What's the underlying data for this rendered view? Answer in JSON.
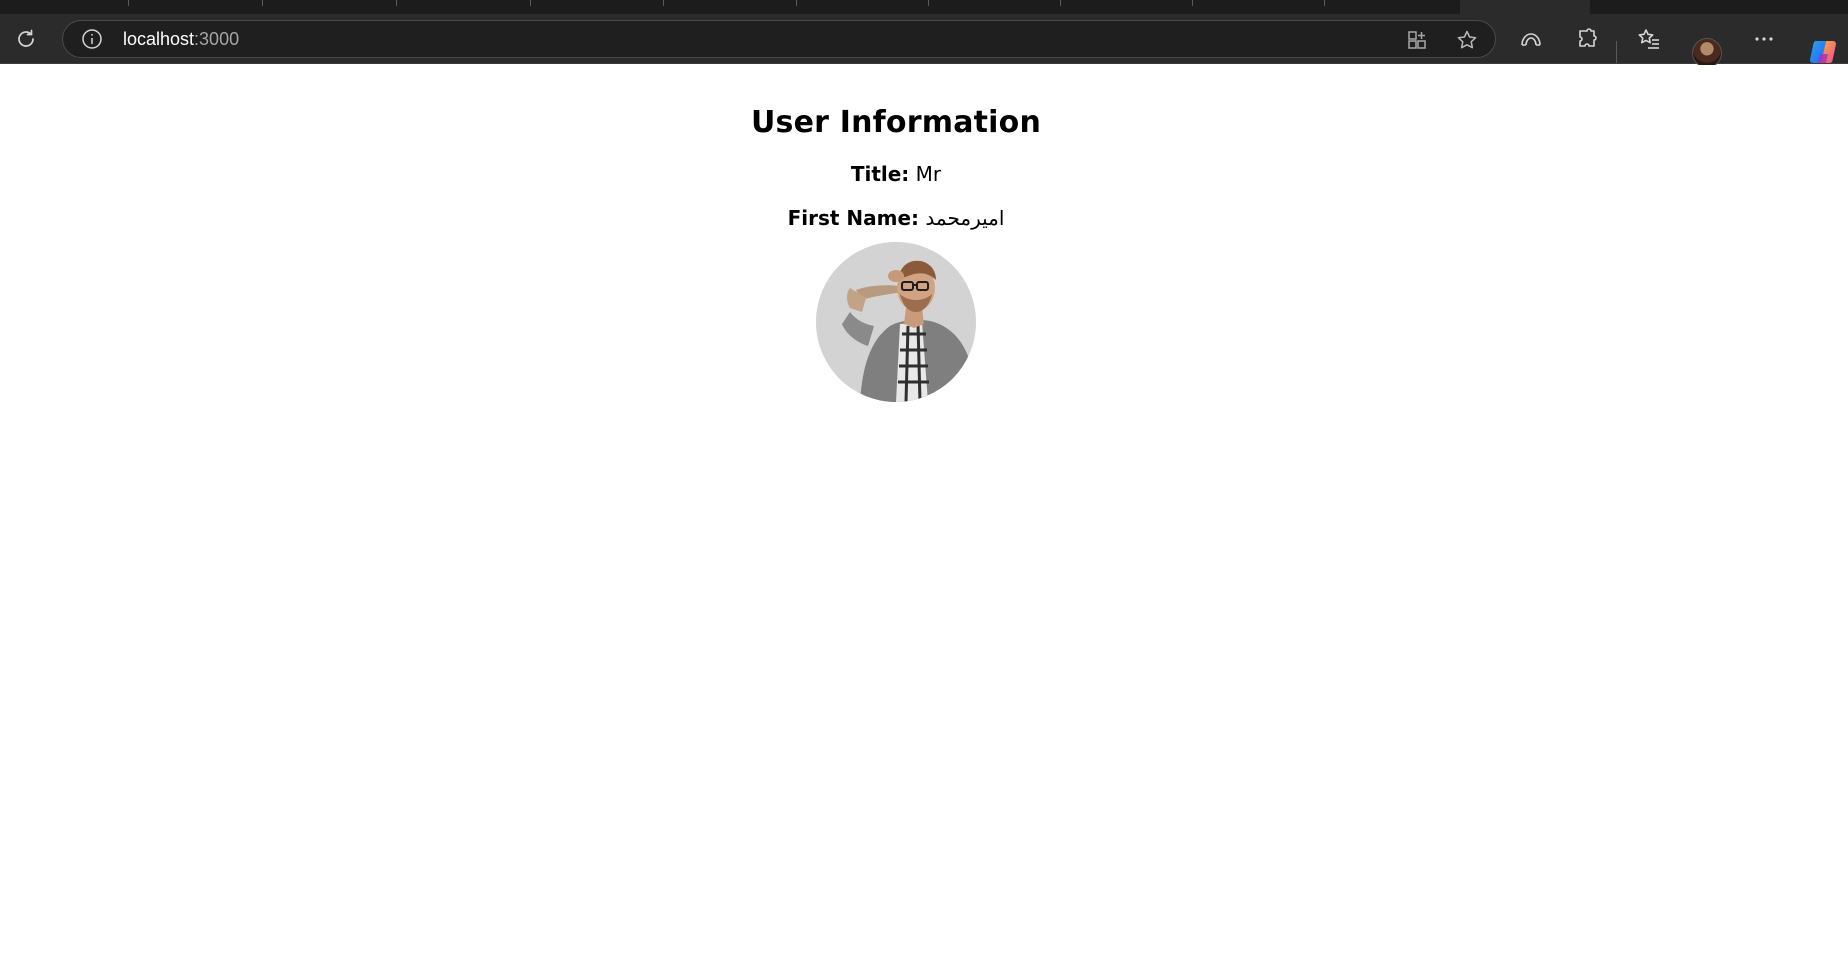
{
  "browser": {
    "url_host": "localhost",
    "url_port": ":3000",
    "icons": {
      "reload": "reload-icon",
      "site_info": "info-icon",
      "apps": "apps-icon",
      "favorite": "star-icon",
      "browser_essentials": "essentials-icon",
      "extensions": "puzzle-icon",
      "favorites_list": "favorites-icon",
      "profile": "avatar",
      "more": "more-icon",
      "copilot": "copilot-icon"
    },
    "colors": {
      "chrome": "#2b2b2b",
      "address_bar": "#1f1f1f",
      "tab_strip": "#1c1c1c"
    }
  },
  "user": {
    "heading": "User Information",
    "title_label": "Title:",
    "title_value": "Mr",
    "first_name_label": "First Name:",
    "first_name_value": "امیرمحمد",
    "photo": "user-photo"
  }
}
